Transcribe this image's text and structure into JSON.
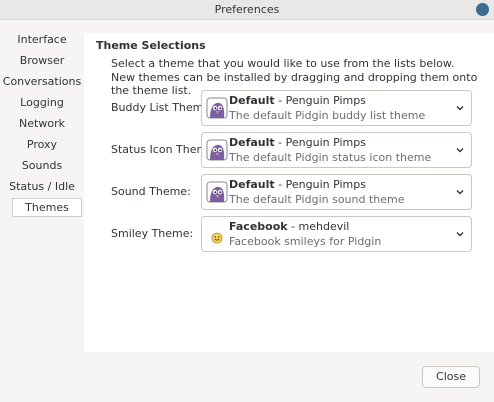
{
  "window": {
    "title": "Preferences"
  },
  "sidebar": {
    "items": [
      {
        "label": "Interface"
      },
      {
        "label": "Browser"
      },
      {
        "label": "Conversations"
      },
      {
        "label": "Logging"
      },
      {
        "label": "Network"
      },
      {
        "label": "Proxy"
      },
      {
        "label": "Sounds"
      },
      {
        "label": "Status / Idle"
      },
      {
        "label": "Themes",
        "selected": true
      }
    ]
  },
  "panel": {
    "section_title": "Theme Selections",
    "desc_line1": "Select a theme that you would like to use from the lists below.",
    "desc_line2": "New themes can be installed by dragging and dropping them onto the theme list.",
    "rows": [
      {
        "label": "Buddy List Theme:",
        "name": "Default",
        "author": " - Penguin Pimps",
        "description": "The default Pidgin buddy list theme",
        "icon": "pidgin-icon"
      },
      {
        "label": "Status Icon Theme:",
        "name": "Default",
        "author": " - Penguin Pimps",
        "description": "The default Pidgin status icon theme",
        "icon": "pidgin-icon"
      },
      {
        "label": "Sound Theme:",
        "name": "Default",
        "author": " - Penguin Pimps",
        "description": "The default Pidgin sound theme",
        "icon": "pidgin-icon"
      },
      {
        "label": "Smiley Theme:",
        "name": "Facebook",
        "author": " - mehdevil",
        "description": "Facebook smileys for Pidgin",
        "icon": "smiley-icon"
      }
    ]
  },
  "footer": {
    "close_label": "Close"
  },
  "colors": {
    "close_circle": "#3d6e8f",
    "pidgin_purple": "#7b5ea7"
  }
}
